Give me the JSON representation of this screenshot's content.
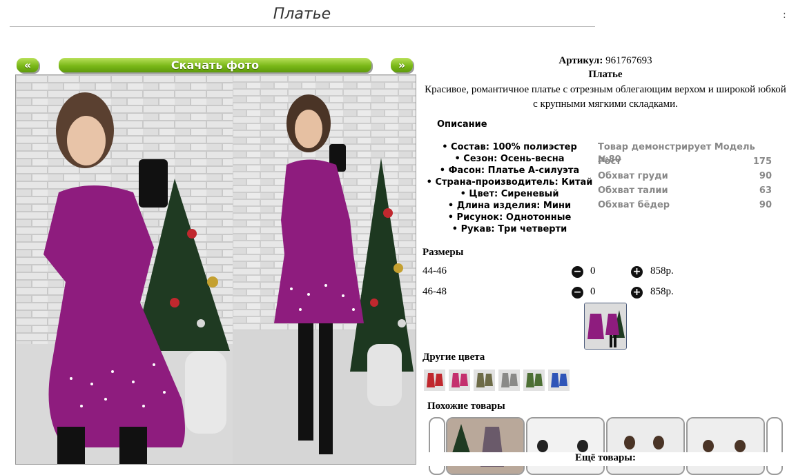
{
  "page": {
    "title": "Платье",
    "corner_mark": ":"
  },
  "gallery": {
    "prev_label": "«",
    "download_label": "Скачать фото",
    "next_label": "»"
  },
  "product": {
    "article_label": "Артикул:",
    "article_value": "961767693",
    "name": "Платье",
    "description": "Красивое, романтичное платье с отрезным облегающим верхом и широкой юбкой с крупными мягкими складками."
  },
  "description_section": {
    "heading": "Описание",
    "specs": [
      "• Состав: 100% полиэстер",
      "• Сезон: Осень-весна",
      "• Фасон: Платье А-силуэта",
      "• Страна-производитель: Китай",
      "• Цвет: Сиреневый",
      "• Длина изделия: Мини",
      "• Рисунок: Однотонные",
      "• Рукав: Три четверти"
    ]
  },
  "model": {
    "rows": [
      {
        "label": "Товар демонстрирует Модель №80",
        "value": ""
      },
      {
        "label": "Рост",
        "value": "175"
      },
      {
        "label": "Обхват груди",
        "value": "90"
      },
      {
        "label": "Обхват талии",
        "value": "63"
      },
      {
        "label": "Обхват бёдер",
        "value": "90"
      }
    ]
  },
  "sizes": {
    "heading": "Размеры",
    "rows": [
      {
        "size": "44-46",
        "qty": "0",
        "price": "858р.",
        "minus_label": "−",
        "plus_label": "+"
      },
      {
        "size": "46-48",
        "qty": "0",
        "price": "858р.",
        "minus_label": "−",
        "plus_label": "+"
      }
    ]
  },
  "colors": {
    "heading": "Другие цвета",
    "swatches": [
      "#c0282e",
      "#c4306e",
      "#6d6b47",
      "#8a8a88",
      "#4d6f34",
      "#2f55b8"
    ]
  },
  "similar": {
    "heading": "Похожие товары"
  },
  "more": {
    "label": "Ещё товары:"
  },
  "palette": {
    "accent_green": "#7ab818",
    "dress_purple": "#8e1c7e",
    "muted_text": "#888888"
  }
}
